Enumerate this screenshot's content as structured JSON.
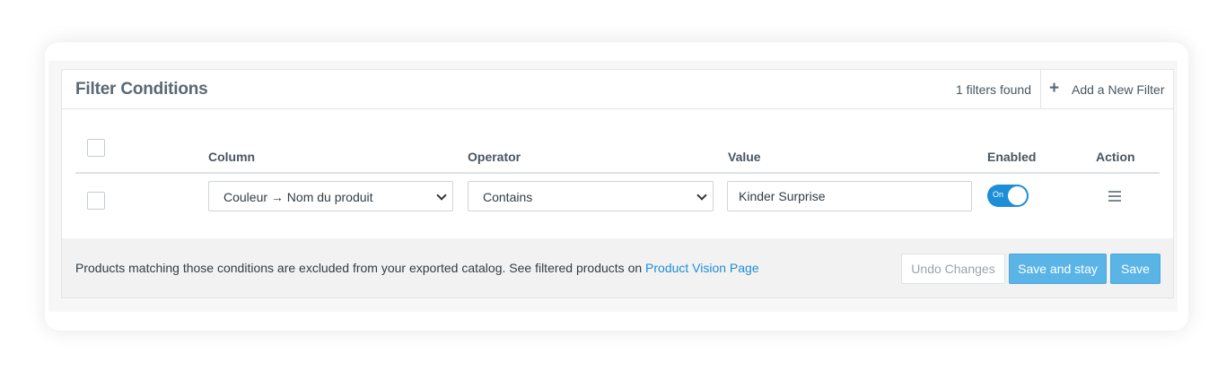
{
  "header": {
    "title": "Filter Conditions",
    "filters_count": "1 filters found",
    "add_filter_label": "Add a New Filter",
    "add_filter_icon": "plus-icon"
  },
  "table": {
    "columns": {
      "column": "Column",
      "operator": "Operator",
      "value": "Value",
      "enabled": "Enabled",
      "action": "Action"
    },
    "rows": [
      {
        "column_value": "Couleur → Nom du produit",
        "operator_value": "Contains",
        "value": "Kinder Surprise",
        "enabled_label": "On",
        "enabled": true,
        "action_icon": "hamburger-menu-icon"
      }
    ]
  },
  "footer": {
    "message": "Products matching those conditions are excluded from your exported catalog. See filtered products on ",
    "link_text": "Product Vision Page",
    "undo_label": "Undo Changes",
    "save_stay_label": "Save and stay",
    "save_label": "Save"
  },
  "colors": {
    "accent": "#1e8ed6",
    "button_primary": "#5ab4e6",
    "title": "#5a6873"
  }
}
